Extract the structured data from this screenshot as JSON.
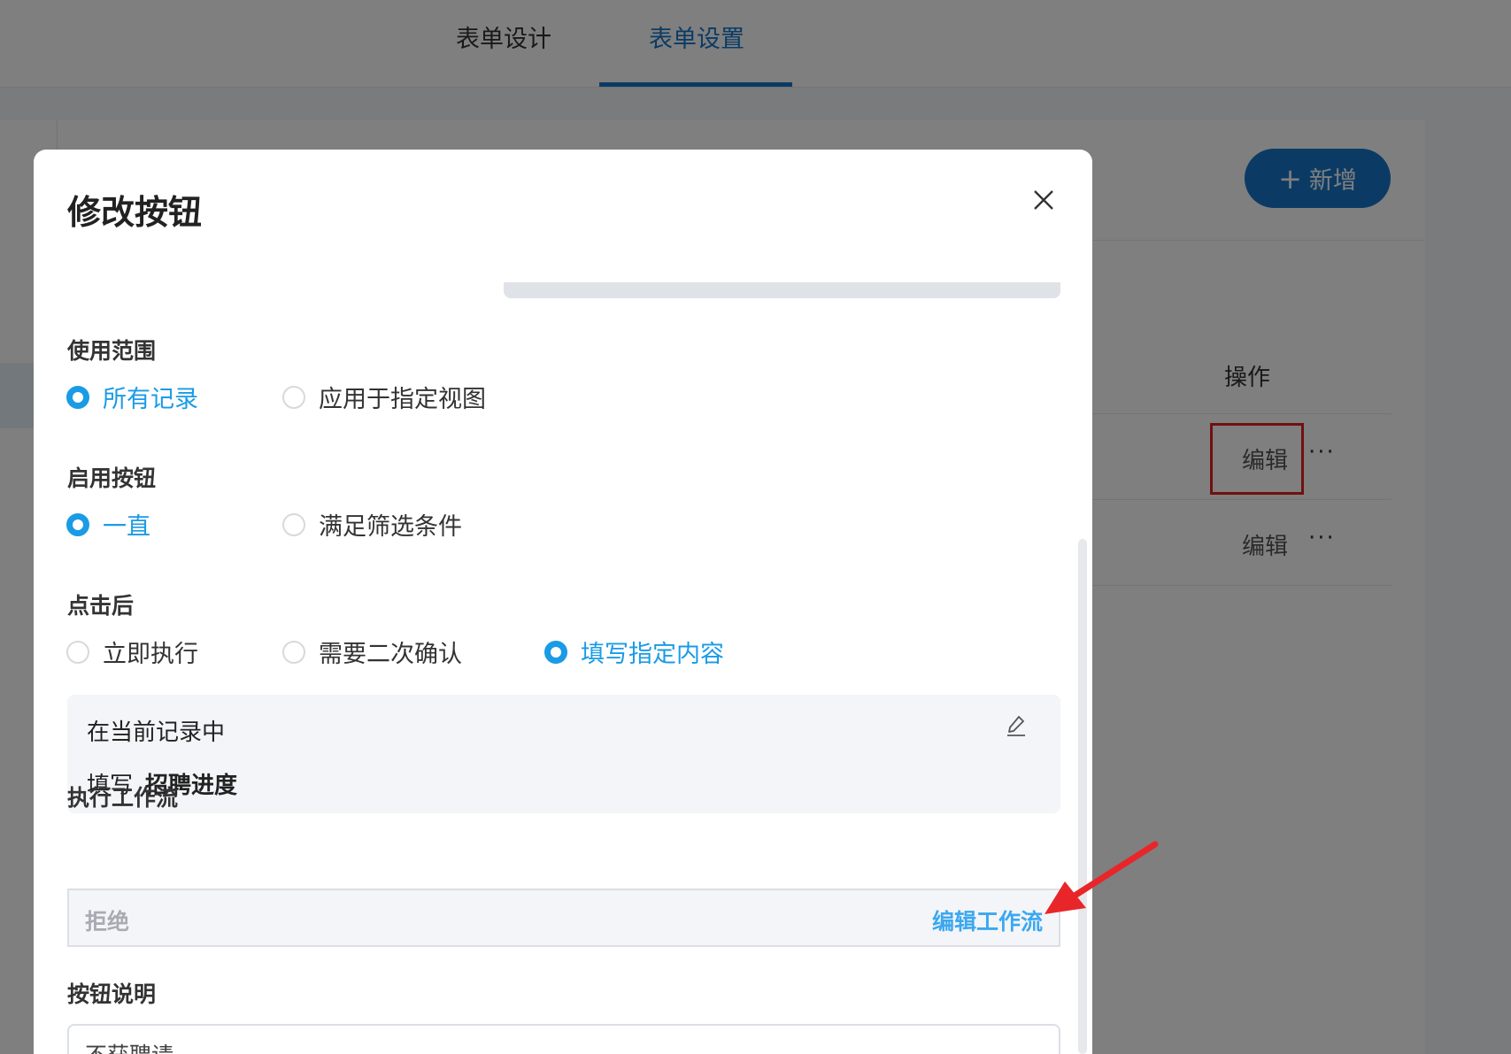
{
  "tabs": [
    {
      "label": "表单设计"
    },
    {
      "label": "表单设置"
    }
  ],
  "toolbar": {
    "add_label": "新增"
  },
  "table": {
    "header_action": "操作",
    "rows": [
      {
        "edit_label": "编辑",
        "more": "···"
      },
      {
        "edit_label": "编辑",
        "more": "···"
      }
    ]
  },
  "modal": {
    "title": "修改按钮",
    "scope": {
      "label": "使用范围",
      "options": [
        "所有记录",
        "应用于指定视图"
      ],
      "selected": "所有记录"
    },
    "enable": {
      "label": "启用按钮",
      "options": [
        "一直",
        "满足筛选条件"
      ],
      "selected": "一直"
    },
    "after_click": {
      "label": "点击后",
      "options": [
        "立即执行",
        "需要二次确认",
        "填写指定内容"
      ],
      "selected": "填写指定内容"
    },
    "fill": {
      "line1": "在当前记录中",
      "line2_prefix": "填写",
      "line2_field": "招聘进度"
    },
    "workflow": {
      "label": "执行工作流",
      "value": "拒绝",
      "edit_link": "编辑工作流"
    },
    "description": {
      "label": "按钮说明",
      "value": "不获聘请"
    }
  },
  "colors": {
    "accent": "#1677c9",
    "radio_selected": "#1a9be6",
    "highlight_box": "#e02020",
    "annotation_arrow": "#e8262a"
  }
}
